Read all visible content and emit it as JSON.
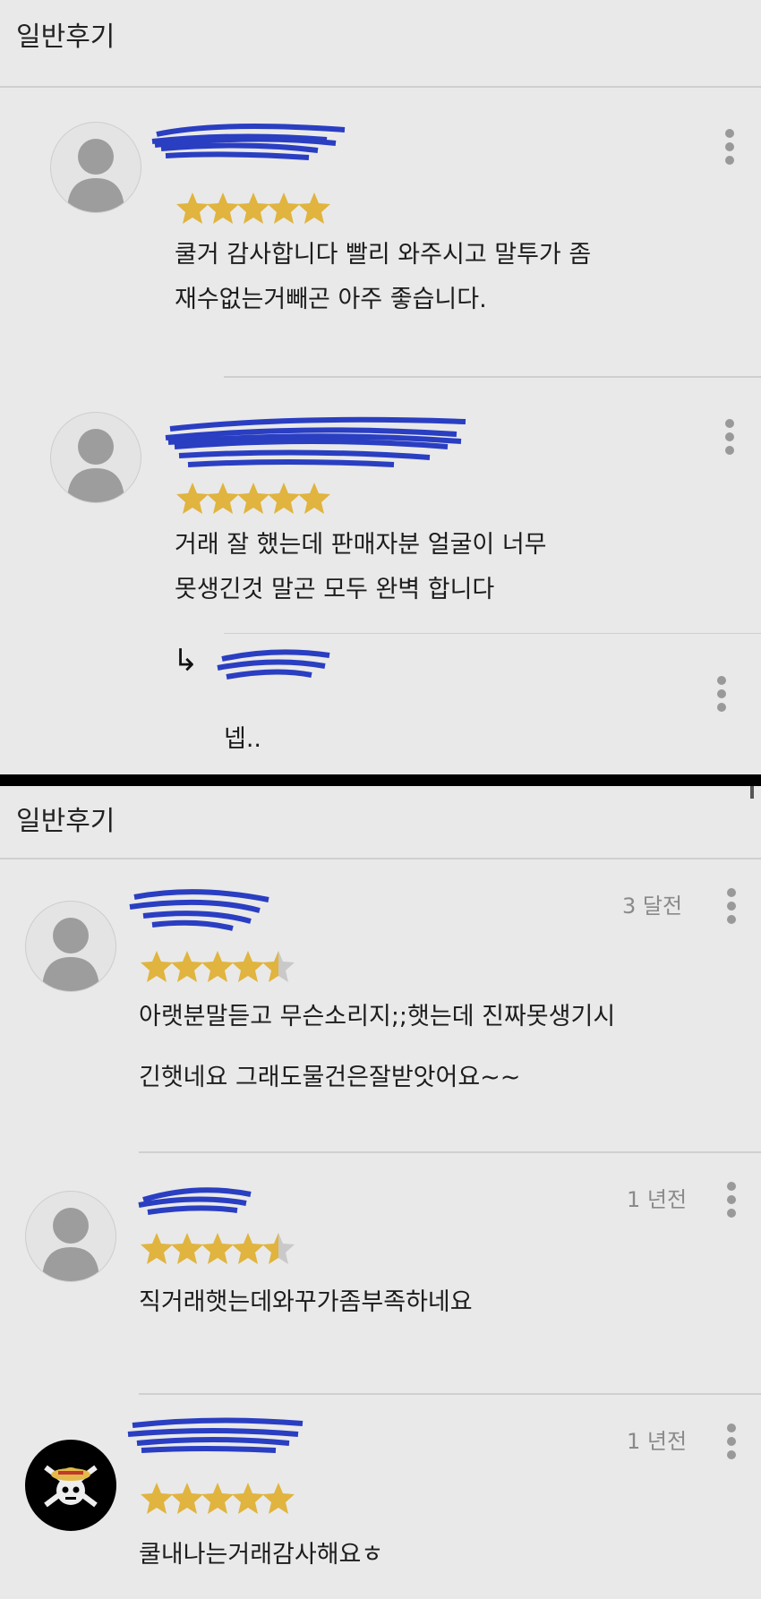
{
  "panel1": {
    "header": "일반후기",
    "reviews": [
      {
        "stars": 5,
        "lines": [
          "쿨거 감사합니다 빨리 와주시고 말투가 좀",
          "재수없는거빼곤 아주 좋습니다."
        ]
      },
      {
        "stars": 5,
        "lines": [
          "거래 잘 했는데 판매자분 얼굴이 너무",
          "못생긴것 말곤 모두 완벽 합니다"
        ]
      }
    ],
    "reply": {
      "arrow": "↳",
      "text": "넵.."
    }
  },
  "panel2": {
    "header": "일반후기",
    "reviews": [
      {
        "time": "3 달전",
        "stars": 4.5,
        "lines": [
          "아랫분말듣고 무슨소리지;;햇는데 진짜못생기시",
          "긴햇네요 그래도물건은잘받앗어요~~"
        ]
      },
      {
        "time": "1 년전",
        "stars": 4.5,
        "lines": [
          "직거래햇는데와꾸가좀부족하네요"
        ]
      },
      {
        "time": "1 년전",
        "stars": 5,
        "lines": [
          "쿨내나는거래감사해요ㅎ"
        ]
      }
    ]
  },
  "colors": {
    "background": "#e9e9e9",
    "star": "#e0b43e",
    "star_empty": "#c9c9c9",
    "scribble": "#2a3ec2"
  },
  "icons": [
    "default-avatar-icon",
    "jolly-roger-avatar-icon",
    "star-icon",
    "kebab-menu-icon",
    "reply-arrow-icon"
  ]
}
